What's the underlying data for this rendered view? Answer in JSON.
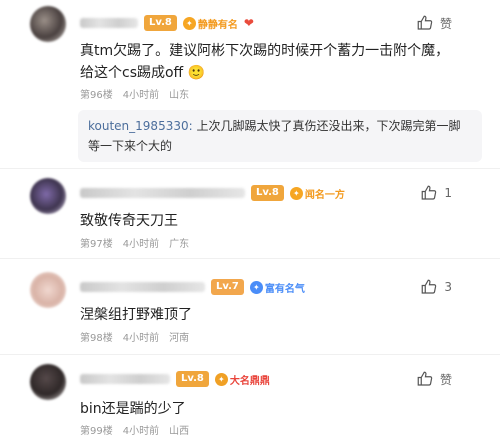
{
  "comments": [
    {
      "level": "Lv.8",
      "medal": "静静有名",
      "content": "真tm欠踢了。建议阿彬下次踢的时候开个蓄力一击附个魔，给这个cs踢成off 🙂",
      "floor": "第96楼",
      "time": "4小时前",
      "location": "山东",
      "like_label": "赞",
      "reply": {
        "author": "kouten_1985330:",
        "text": "上次几脚踢太快了真伤还没出来，下次踢完第一脚等一下来个大的"
      }
    },
    {
      "level": "Lv.8",
      "medal": "闻名一方",
      "content": "致敬传奇天刀王",
      "floor": "第97楼",
      "time": "4小时前",
      "location": "广东",
      "like_label": "1"
    },
    {
      "level": "Lv.7",
      "medal": "富有名气",
      "content": "涅槃组打野难顶了",
      "floor": "第98楼",
      "time": "4小时前",
      "location": "河南",
      "like_label": "3"
    },
    {
      "level": "Lv.8",
      "medal": "大名鼎鼎",
      "content": "bin还是踹的少了",
      "floor": "第99楼",
      "time": "4小时前",
      "location": "山西",
      "like_label": "赞"
    }
  ],
  "colors": {
    "level": "#f0a63c",
    "medal_orange": "#f39a1e",
    "medal_blue": "#4a8df8",
    "medal_red": "#e9443b"
  }
}
